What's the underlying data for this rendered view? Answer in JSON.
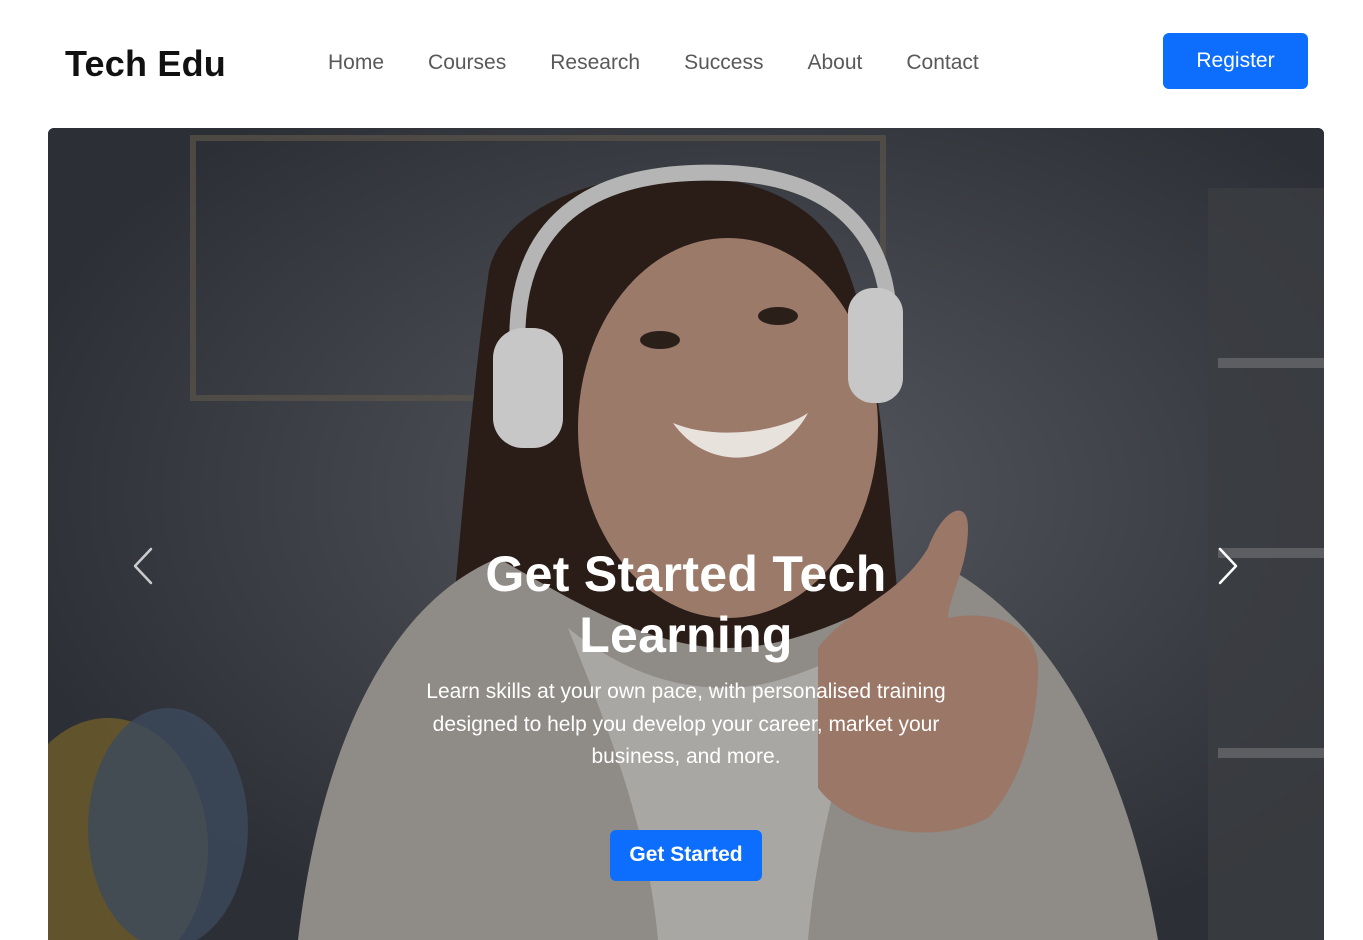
{
  "brand": {
    "name": "Tech Edu"
  },
  "nav": {
    "items": [
      {
        "label": "Home"
      },
      {
        "label": "Courses"
      },
      {
        "label": "Research"
      },
      {
        "label": "Success"
      },
      {
        "label": "About"
      },
      {
        "label": "Contact"
      }
    ],
    "register_label": "Register"
  },
  "hero": {
    "title": "Get Started Tech Learning",
    "text": "Learn skills at your own pace, with personalised training designed to help you develop your career, market your business, and more.",
    "cta_label": "Get Started",
    "prev_icon": "chevron-left-icon",
    "next_icon": "chevron-right-icon"
  },
  "colors": {
    "accent": "#0d6efd",
    "brand_text": "#111111",
    "nav_text": "#595959",
    "hero_overlay": "#2f3238"
  }
}
